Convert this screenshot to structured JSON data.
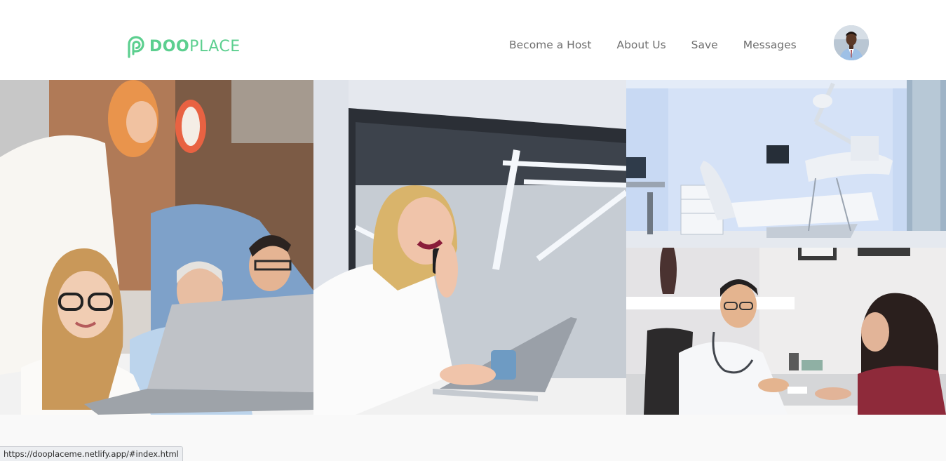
{
  "brand": {
    "name_bold": "DOO",
    "name_light": "PLACE",
    "color": "#5ccf8f",
    "icon": "dooplace-logo-icon"
  },
  "nav": {
    "items": [
      {
        "label": "Become a Host"
      },
      {
        "label": "About Us"
      },
      {
        "label": "Save"
      },
      {
        "label": "Messages"
      }
    ]
  },
  "user": {
    "avatar_icon": "user-avatar-photo"
  },
  "gallery": {
    "images": [
      {
        "alt": "team-at-laptop-photo"
      },
      {
        "alt": "woman-on-phone-photo"
      },
      {
        "alt": "dental-clinic-photo"
      },
      {
        "alt": "doctor-consultation-photo"
      }
    ]
  },
  "status_bar": {
    "url": "https://dooplaceme.netlify.app/#index.html"
  }
}
